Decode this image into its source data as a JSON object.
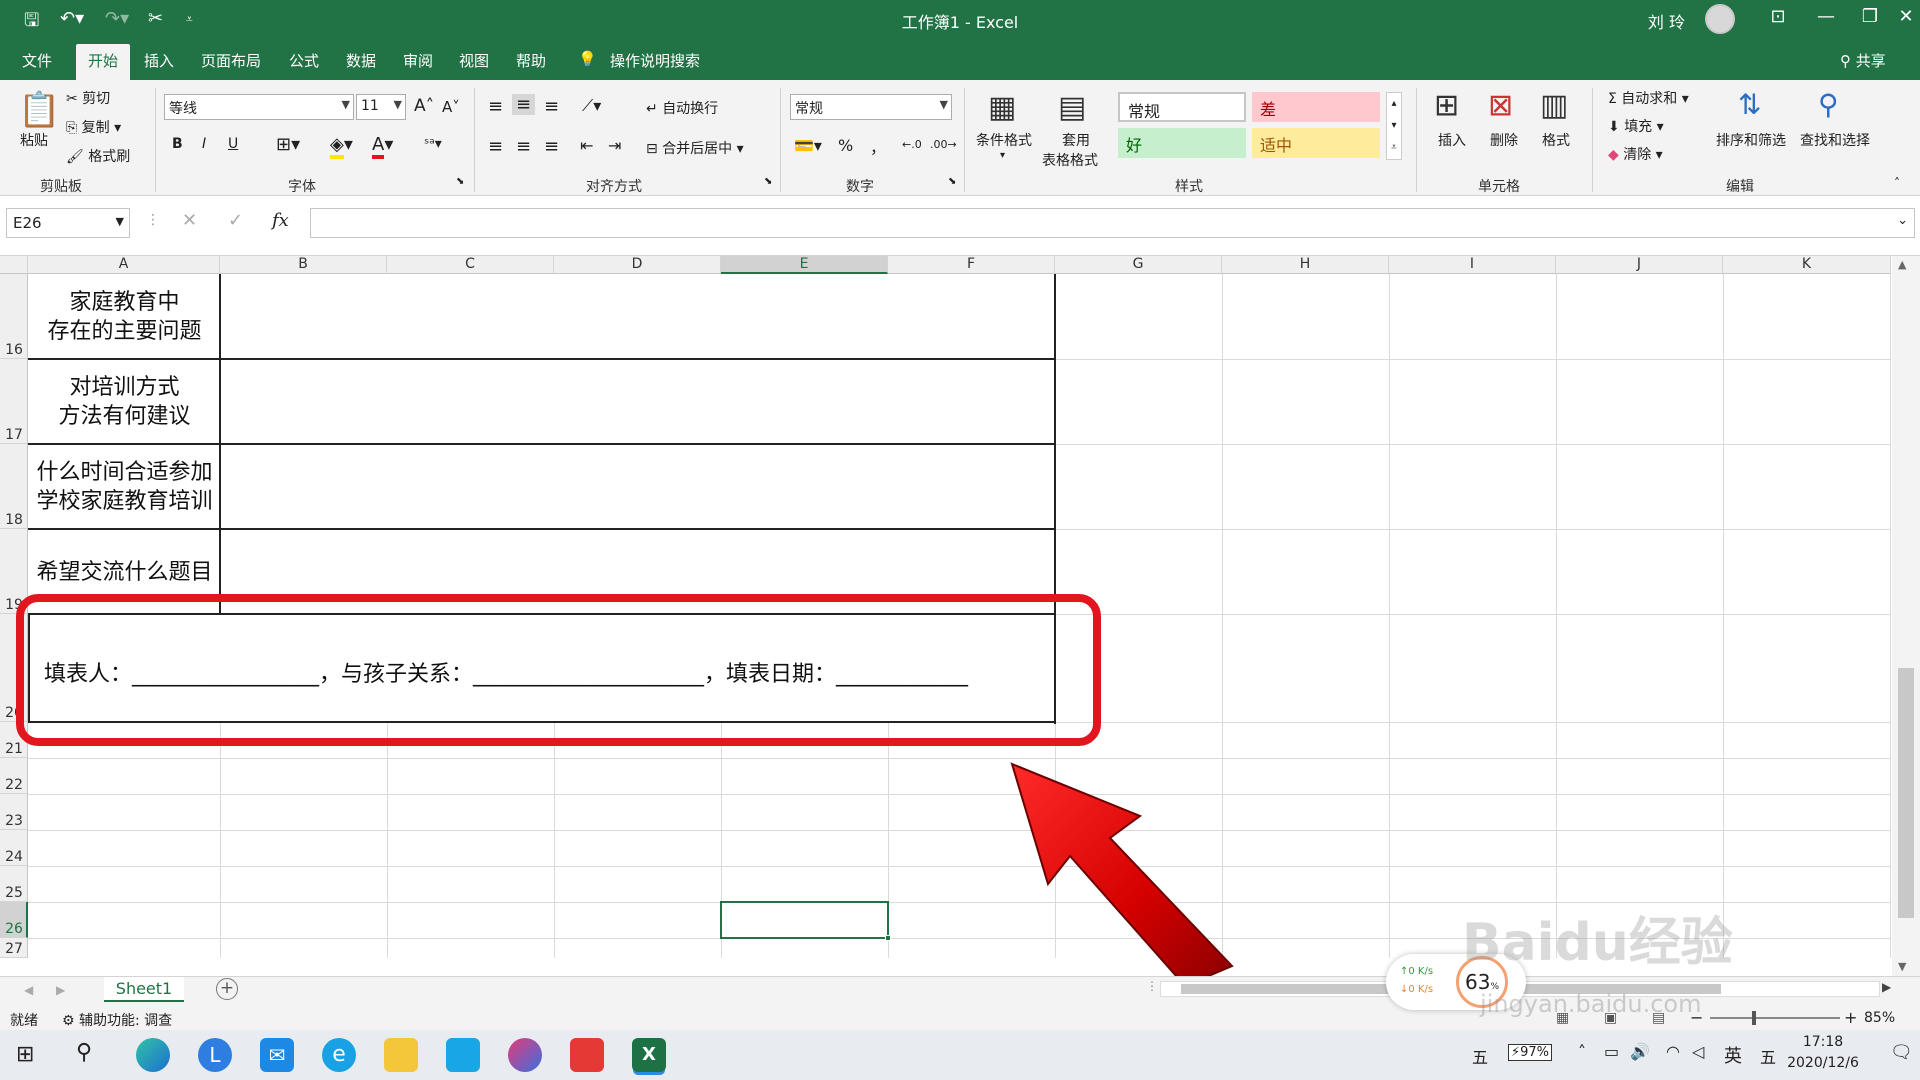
{
  "titlebar": {
    "title": "工作簿1 - Excel",
    "user": "刘 玲"
  },
  "tabs": [
    "文件",
    "开始",
    "插入",
    "页面布局",
    "公式",
    "数据",
    "审阅",
    "视图",
    "帮助"
  ],
  "tell_me": "操作说明搜索",
  "share": "共享",
  "ribbon": {
    "clipboard": {
      "paste": "粘贴",
      "cut": "剪切",
      "copy": "复制",
      "format_painter": "格式刷",
      "label": "剪贴板"
    },
    "font": {
      "name": "等线",
      "size": "11",
      "label": "字体",
      "bold": "B",
      "italic": "I",
      "underline": "U"
    },
    "align": {
      "wrap": "自动换行",
      "merge": "合并后居中",
      "label": "对齐方式"
    },
    "number": {
      "format": "常规",
      "percent": "%",
      "comma": "，",
      "label": "数字"
    },
    "styles": {
      "cond": "条件格式",
      "table1": "套用",
      "table2": "表格格式",
      "normal": "常规",
      "bad": "差",
      "good": "好",
      "neutral": "适中",
      "label": "样式"
    },
    "cells": {
      "insert": "插入",
      "delete": "删除",
      "format": "格式",
      "label": "单元格"
    },
    "edit": {
      "autosum": "自动求和",
      "fill": "填充",
      "clear": "清除",
      "sort": "排序和筛选",
      "find": "查找和选择",
      "label": "编辑"
    }
  },
  "formula": {
    "namebox": "E26",
    "fx": "fx",
    "value": ""
  },
  "columns": [
    "A",
    "B",
    "C",
    "D",
    "E",
    "F",
    "G",
    "H",
    "I",
    "J",
    "K"
  ],
  "rows": [
    "16",
    "17",
    "18",
    "19",
    "20",
    "21",
    "22",
    "23",
    "24",
    "25",
    "26",
    "27"
  ],
  "cells": {
    "r16a": "家庭教育中",
    "r16b": "存在的主要问题",
    "r17a": "对培训方式",
    "r17b": "方法有何建议",
    "r18a": "什么时间合适参加",
    "r18b": "学校家庭教育培训",
    "r19": "希望交流什么题目",
    "r20": "填表人：_________________，与孩子关系：_____________________，填表日期：____________"
  },
  "sheet": {
    "tab": "Sheet1",
    "add": "+"
  },
  "status": {
    "ready": "就绪",
    "accessibility": "辅助功能: 调查",
    "zoom": "85%"
  },
  "net": {
    "up": "0 K/s",
    "down": "0 K/s",
    "percent": "63"
  },
  "watermark": {
    "text": "Baidu经验",
    "sub": "jingyan.baidu.com"
  },
  "tray": {
    "ime1": "五",
    "battery": "97%",
    "lang": "英",
    "ime2": "五",
    "time": "17:18",
    "date": "2020/12/6"
  },
  "colors": {
    "accent": "#217346",
    "annotation": "#e2161f"
  }
}
